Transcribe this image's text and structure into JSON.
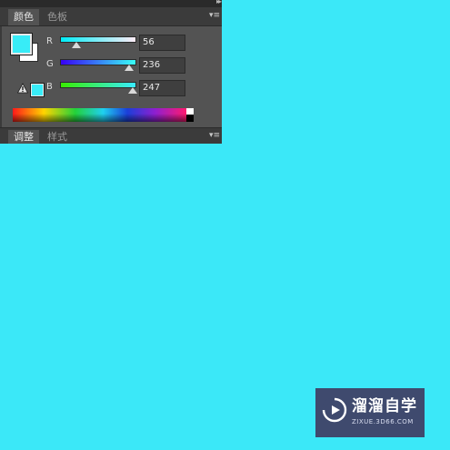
{
  "color_panel": {
    "tabs": [
      {
        "label": "颜色",
        "active": true
      },
      {
        "label": "色板",
        "active": false
      }
    ],
    "foreground_color": "#38ECF7",
    "background_color": "#FFFFFF",
    "channels": [
      {
        "label": "R",
        "value": "56",
        "level": 0.22,
        "gradient": [
          "#00ECF7",
          "#FFECF7"
        ]
      },
      {
        "label": "G",
        "value": "236",
        "level": 0.93,
        "gradient": [
          "#3800F7",
          "#38FFF7"
        ]
      },
      {
        "label": "B",
        "value": "247",
        "level": 0.97,
        "gradient": [
          "#38EC00",
          "#38ECFF"
        ]
      }
    ],
    "out_of_gamut_icon": "warning-triangle-icon",
    "spectrum_icon": "color-ramp"
  },
  "adjust_panel": {
    "tabs": [
      {
        "label": "调整",
        "active": true
      },
      {
        "label": "样式",
        "active": false
      }
    ]
  },
  "canvas": {
    "fill_color": "#3BE8F8"
  },
  "watermark": {
    "name": "溜溜自学",
    "url": "ZIXUE.3D66.COM"
  }
}
